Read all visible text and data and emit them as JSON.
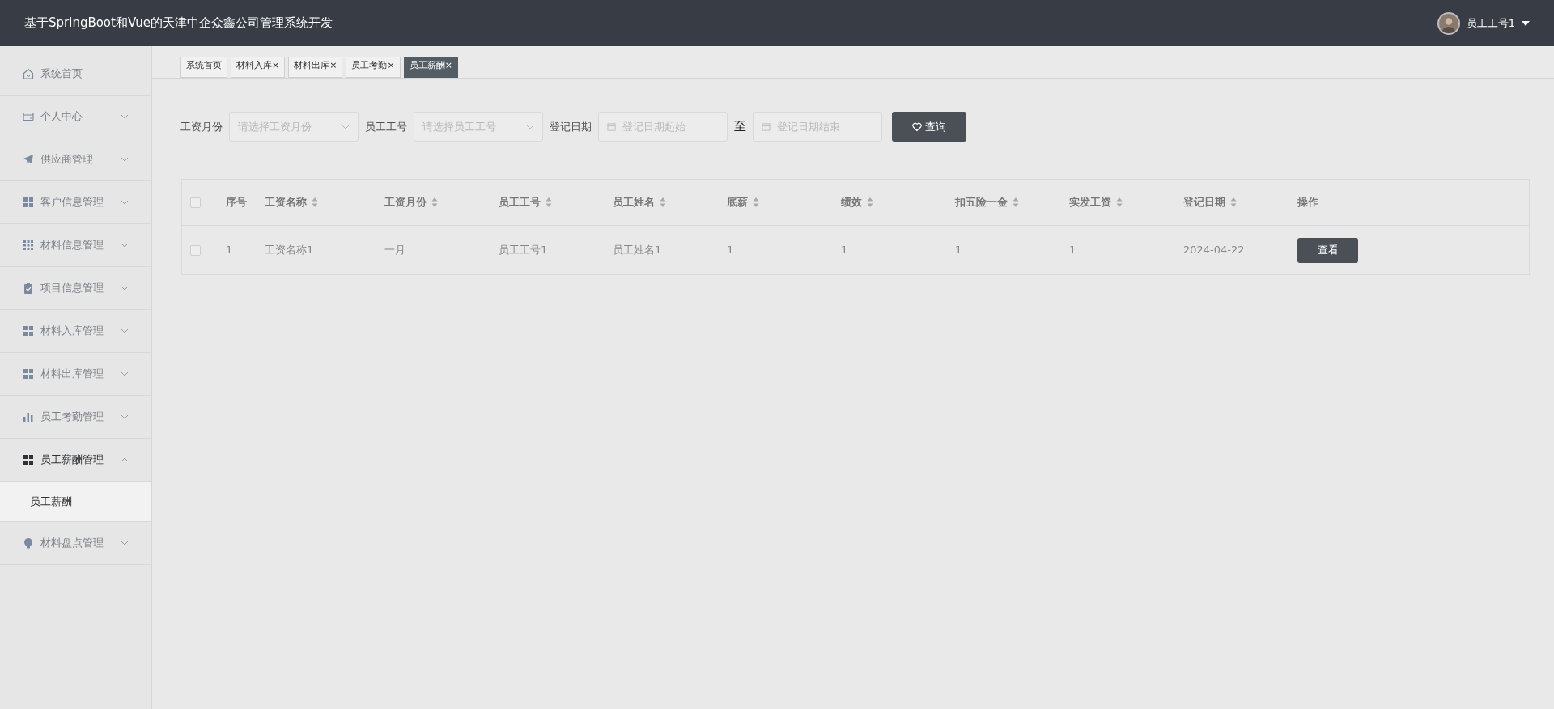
{
  "header": {
    "title": "基于SpringBoot和Vue的天津中企众鑫公司管理系统开发",
    "user": "员工工号1"
  },
  "sidebar": {
    "items": [
      {
        "label": "系统首页",
        "expandable": false,
        "expanded": false,
        "selected": false
      },
      {
        "label": "个人中心",
        "expandable": true,
        "expanded": false,
        "selected": false
      },
      {
        "label": "供应商管理",
        "expandable": true,
        "expanded": false,
        "selected": false
      },
      {
        "label": "客户信息管理",
        "expandable": true,
        "expanded": false,
        "selected": false
      },
      {
        "label": "材料信息管理",
        "expandable": true,
        "expanded": false,
        "selected": false
      },
      {
        "label": "项目信息管理",
        "expandable": true,
        "expanded": false,
        "selected": false
      },
      {
        "label": "材料入库管理",
        "expandable": true,
        "expanded": false,
        "selected": false
      },
      {
        "label": "材料出库管理",
        "expandable": true,
        "expanded": false,
        "selected": false
      },
      {
        "label": "员工考勤管理",
        "expandable": true,
        "expanded": false,
        "selected": false
      },
      {
        "label": "员工薪酬管理",
        "expandable": true,
        "expanded": true,
        "selected": true,
        "children": [
          {
            "label": "员工薪酬",
            "selected": true
          }
        ]
      },
      {
        "label": "材料盘点管理",
        "expandable": true,
        "expanded": false,
        "selected": false
      }
    ]
  },
  "tabs": [
    {
      "label": "系统首页",
      "selected": false
    },
    {
      "label": "材料入库",
      "close": "×",
      "selected": false
    },
    {
      "label": "材料出库",
      "close": "×",
      "selected": false
    },
    {
      "label": "员工考勤",
      "close": "×",
      "selected": false
    },
    {
      "label": "员工薪酬",
      "close": "×",
      "selected": true
    }
  ],
  "filters": [
    {
      "kind": "select",
      "label": "工资月份",
      "placeholder": "请选择工资月份"
    },
    {
      "kind": "select",
      "label": "员工工号",
      "placeholder": "请选择员工工号"
    },
    {
      "kind": "date",
      "label": "登记日期",
      "placeholder": "登记日期起始"
    },
    {
      "kind": "date",
      "label": "至",
      "placeholder": "登记日期结束"
    }
  ],
  "search_button": "查询",
  "table": {
    "select_all_checked": false,
    "columns": [
      {
        "label": "序号",
        "sortable": false
      },
      {
        "label": "工资名称",
        "sortable": true
      },
      {
        "label": "工资月份",
        "sortable": true
      },
      {
        "label": "员工工号",
        "sortable": true
      },
      {
        "label": "员工姓名",
        "sortable": true
      },
      {
        "label": "底薪",
        "sortable": true
      },
      {
        "label": "绩效",
        "sortable": true
      },
      {
        "label": "扣五险一金",
        "sortable": true
      },
      {
        "label": "实发工资",
        "sortable": true
      },
      {
        "label": "登记日期",
        "sortable": true
      },
      {
        "label": "操作",
        "sortable": false
      }
    ],
    "rows": [
      {
        "checked": false,
        "cells": [
          "1",
          "工资名称1",
          "一月",
          "员工工号1",
          "员工姓名1",
          "1",
          "1",
          "1",
          "1",
          "2024-04-22"
        ],
        "action": "查看"
      }
    ]
  }
}
